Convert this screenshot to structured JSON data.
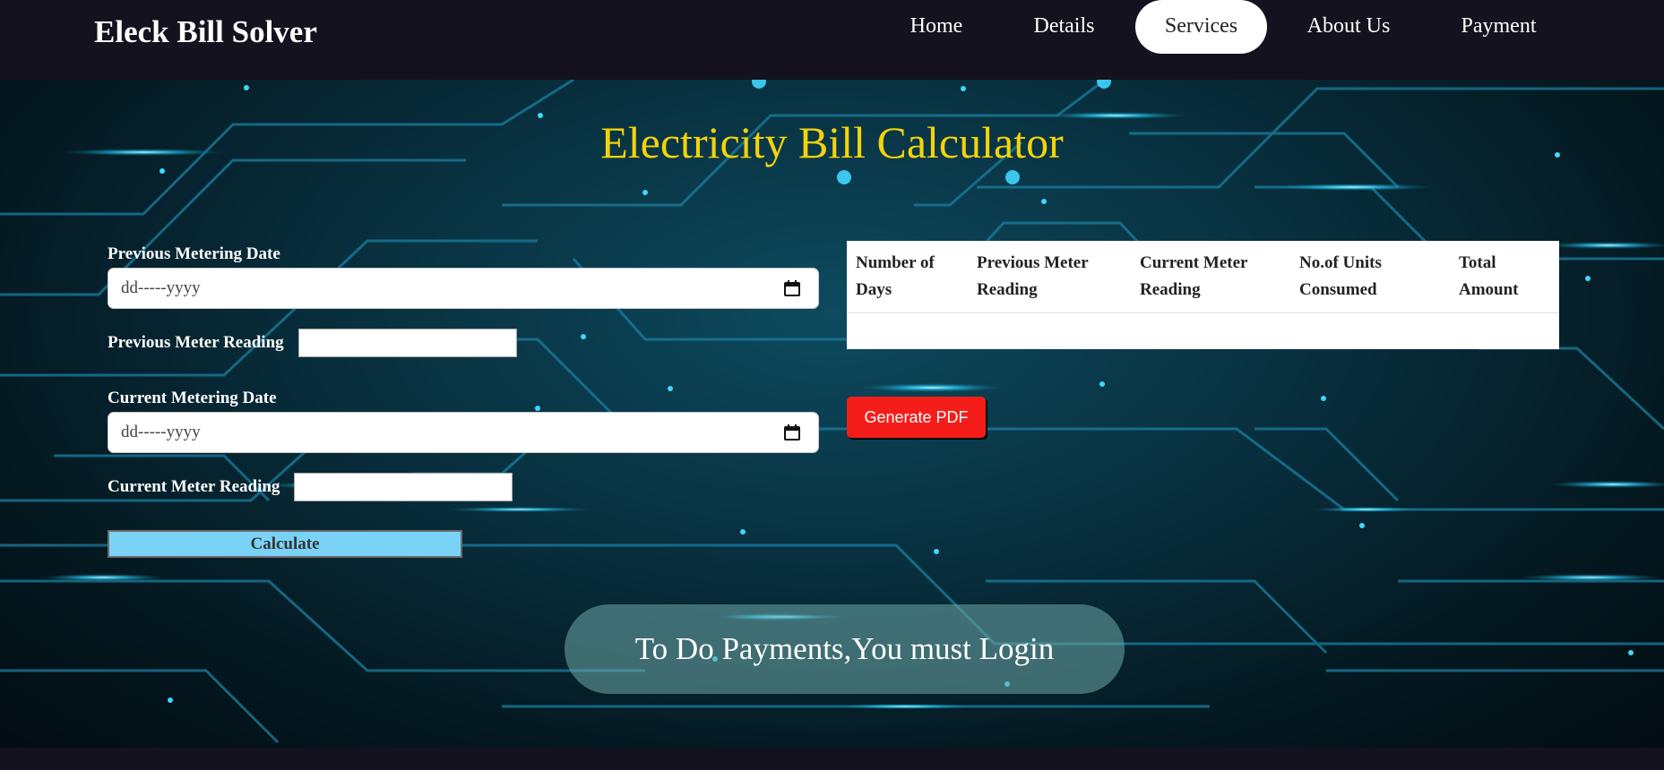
{
  "header": {
    "brand": "Eleck Bill Solver",
    "nav": [
      {
        "label": "Home"
      },
      {
        "label": "Details"
      },
      {
        "label": "Services"
      },
      {
        "label": "About Us"
      },
      {
        "label": "Payment"
      }
    ],
    "active_nav": "Services"
  },
  "main": {
    "title": "Electricity Bill Calculator",
    "form": {
      "prev_date_label": "Previous Metering Date",
      "prev_date_placeholder": "dd-----yyyy",
      "prev_reading_label": "Previous Meter Reading",
      "prev_reading_value": "",
      "curr_date_label": "Current Metering Date",
      "curr_date_placeholder": "dd-----yyyy",
      "curr_reading_label": "Current Meter Reading",
      "curr_reading_value": "",
      "calculate_label": "Calculate"
    },
    "table": {
      "headers": [
        [
          "Number of",
          "Days"
        ],
        [
          "Previous Meter",
          "Reading"
        ],
        [
          "Current Meter",
          "Reading"
        ],
        [
          "No.of Units",
          "Consumed"
        ],
        [
          "Total",
          "Amount"
        ]
      ],
      "rows": []
    },
    "pdf_button_label": "Generate PDF",
    "login_notice": "To Do Payments,You must Login"
  },
  "colors": {
    "title": "#f4d30a",
    "calculate_bg": "#7ad3f7",
    "pdf_bg": "#f51d1a",
    "header_bg": "#13121e"
  },
  "icons": {
    "date_picker": "calendar-icon"
  }
}
